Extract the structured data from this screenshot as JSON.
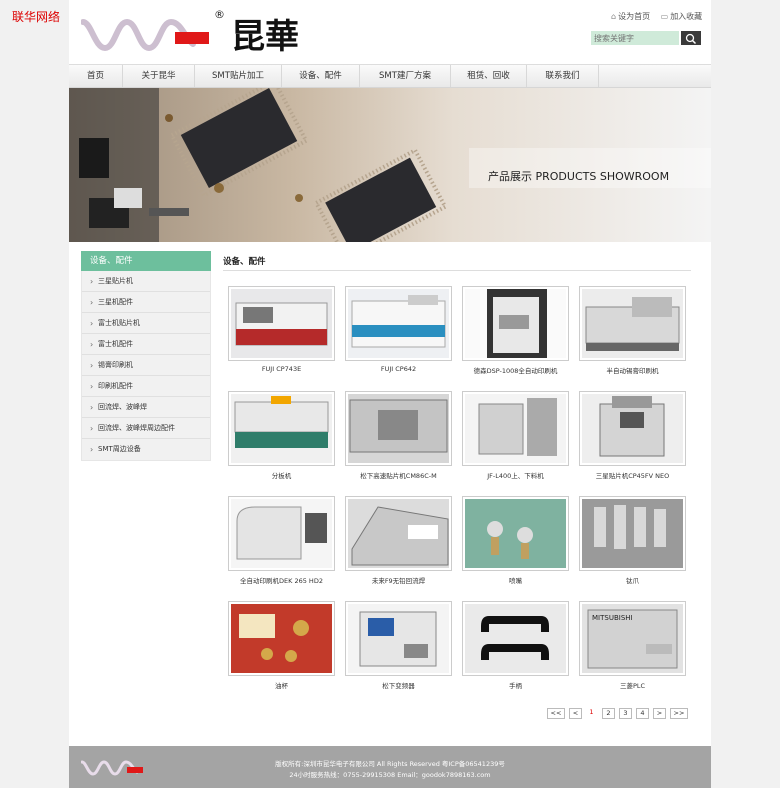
{
  "corner_label": "联华网络",
  "header": {
    "brand_text": "昆華",
    "registered_mark": "®",
    "links": [
      {
        "label": "设为首页",
        "icon": "home-icon"
      },
      {
        "label": "加入收藏",
        "icon": "bookmark-icon"
      }
    ],
    "search_placeholder": "搜索关键字"
  },
  "nav": [
    "首页",
    "关于昆华",
    "SMT贴片加工",
    "设备、配件",
    "SMT建厂方案",
    "租赁、回收",
    "联系我们"
  ],
  "banner": {
    "text": "产品展示 PRODUCTS SHOWROOM"
  },
  "sidebar": {
    "title": "设备、配件",
    "items": [
      "三星贴片机",
      "三星机配件",
      "富士机贴片机",
      "富士机配件",
      "锡膏印刷机",
      "印刷机配件",
      "回流焊、波峰焊",
      "回流焊、波峰焊周边配件",
      "SMT周边设备"
    ]
  },
  "main": {
    "title": "设备、配件",
    "products": [
      "FUJI CP743E",
      "FUJI CP642",
      "德森DSP-1008全自动印刷机",
      "半自动锡膏印刷机",
      "分板机",
      "松下高速贴片机CM86C-M",
      "JF-L400上、下料机",
      "三星贴片机CP45FV NEO",
      "全自动印刷机DEK 265 HD2",
      "未来F9无铅回流焊",
      "喷嘴",
      "钛爪",
      "油杯",
      "松下变频器",
      "手柄",
      "三菱PLC"
    ]
  },
  "pager": [
    "<<",
    "<",
    "1",
    "2",
    "3",
    "4",
    ">",
    ">>"
  ],
  "footer": {
    "line1": "版权所有:深圳市昆华电子有限公司 All Rights Reserved 粤ICP备06541239号",
    "line2": "24小时服务热线：0755-29915308 Email：goodok7898163.com"
  },
  "colors": {
    "accent_green": "#6dbf9d",
    "logo_red": "#e01818",
    "footer_gray": "#a4a4a4"
  }
}
